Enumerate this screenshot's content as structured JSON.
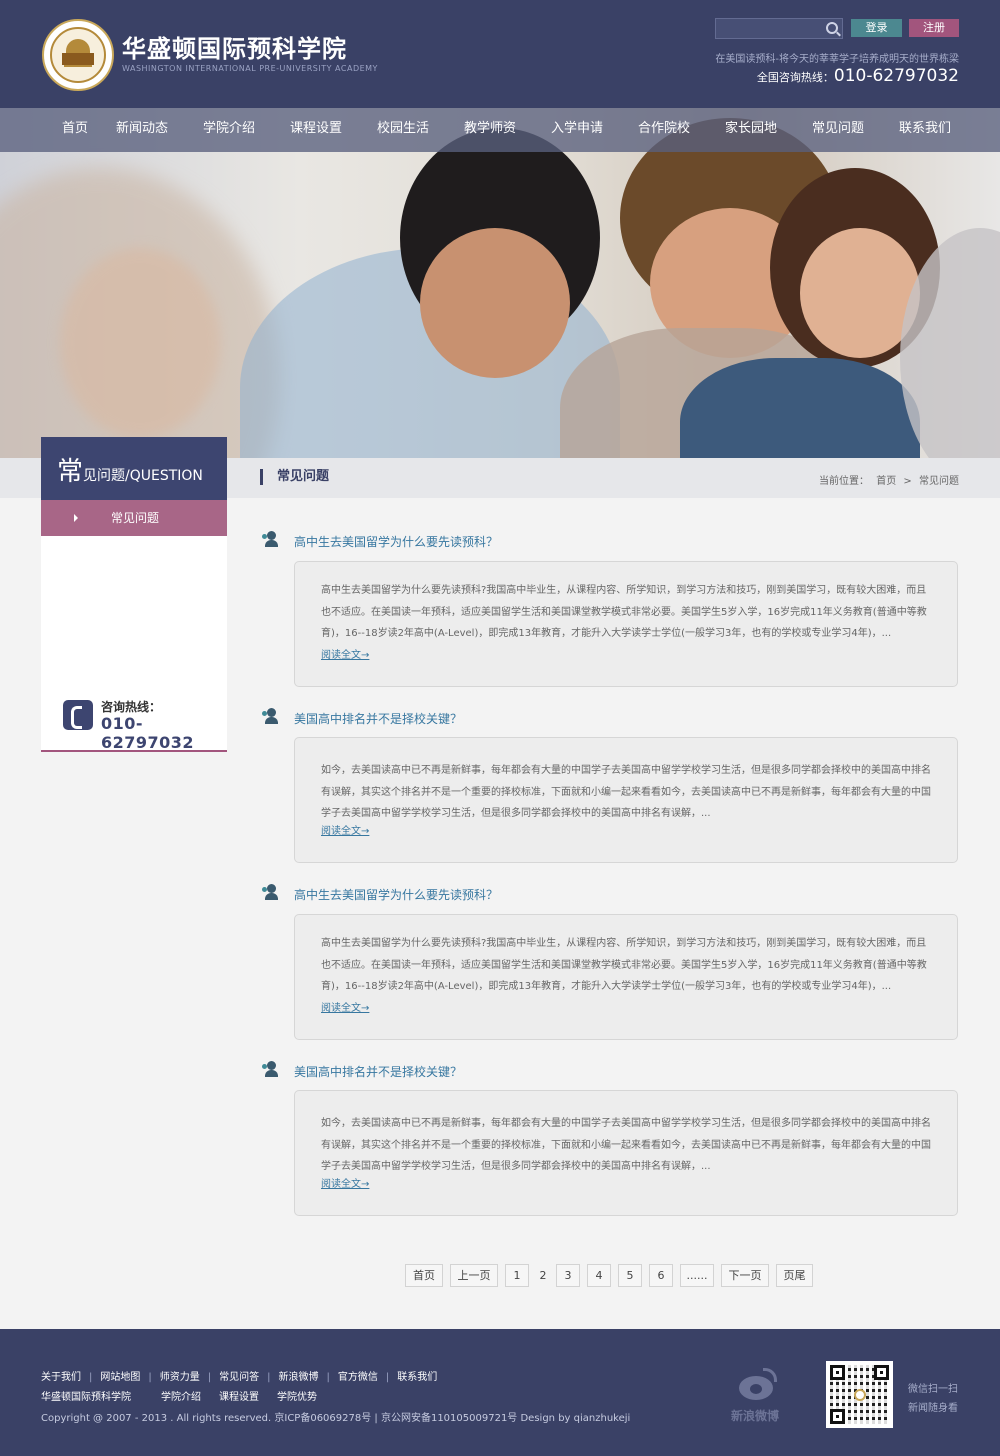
{
  "header": {
    "site_name": "华盛顿国际预科学院",
    "site_name_en": "WASHINGTON INTERNATIONAL PRE-UNIVERSITY ACADEMY",
    "search_placeholder": "",
    "login_label": "登录",
    "register_label": "注册",
    "slogan": "在美国读预科-将今天的莘莘学子培养成明天的世界栋梁",
    "hotline_label": "全国咨询热线：",
    "hotline_number": "010-62797032"
  },
  "nav": {
    "items": [
      {
        "label": "首页"
      },
      {
        "label": "新闻动态"
      },
      {
        "label": "学院介绍"
      },
      {
        "label": "课程设置"
      },
      {
        "label": "校园生活"
      },
      {
        "label": "教学师资"
      },
      {
        "label": "入学申请"
      },
      {
        "label": "合作院校"
      },
      {
        "label": "家长园地"
      },
      {
        "label": "常见问题"
      },
      {
        "label": "联系我们"
      }
    ]
  },
  "sidebar": {
    "title_big": "常",
    "title_rest": "见问题/QUESTION",
    "items": [
      {
        "label": "常见问题"
      }
    ],
    "hotline_label": "咨询热线：",
    "hotline_number": "010-62797032"
  },
  "main": {
    "section_title": "常见问题",
    "breadcrumb": {
      "prefix": "当前位置：",
      "home": "首页",
      "sep": ">",
      "current": "常见问题"
    },
    "read_more": "阅读全文→",
    "articles": [
      {
        "title": "高中生去美国留学为什么要先读预科？",
        "excerpt": "高中生去美国留学为什么要先读预科?我国高中毕业生，从课程内容、所学知识，到学习方法和技巧，刚到美国学习，既有较大困难，而且也不适应。在美国读一年预科，适应美国留学生活和美国课堂教学模式非常必要。美国学生5岁入学，16岁完成11年义务教育(普通中等教育)，16--18岁读2年高中(A-Level)，即完成13年教育，才能升入大学读学士学位(一般学习3年，也有的学校或专业学习4年)，..."
      },
      {
        "title": "美国高中排名并不是择校关键？",
        "excerpt": "如今，去美国读高中已不再是新鲜事，每年都会有大量的中国学子去美国高中留学学校学习生活，但是很多同学都会择校中的美国高中排名有误解，其实这个排名并不是一个重要的择校标准，下面就和小编一起来看看如今，去美国读高中已不再是新鲜事，每年都会有大量的中国学子去美国高中留学学校学习生活，但是很多同学都会择校中的美国高中排名有误解，..."
      },
      {
        "title": "高中生去美国留学为什么要先读预科？",
        "excerpt": "高中生去美国留学为什么要先读预科?我国高中毕业生，从课程内容、所学知识，到学习方法和技巧，刚到美国学习，既有较大困难，而且也不适应。在美国读一年预科，适应美国留学生活和美国课堂教学模式非常必要。美国学生5岁入学，16岁完成11年义务教育(普通中等教育)，16--18岁读2年高中(A-Level)，即完成13年教育，才能升入大学读学士学位(一般学习3年，也有的学校或专业学习4年)，..."
      },
      {
        "title": "美国高中排名并不是择校关键？",
        "excerpt": "如今，去美国读高中已不再是新鲜事，每年都会有大量的中国学子去美国高中留学学校学习生活，但是很多同学都会择校中的美国高中排名有误解，其实这个排名并不是一个重要的择校标准，下面就和小编一起来看看如今，去美国读高中已不再是新鲜事，每年都会有大量的中国学子去美国高中留学学校学习生活，但是很多同学都会择校中的美国高中排名有误解，..."
      }
    ]
  },
  "pagination": {
    "first": "首页",
    "prev": "上一页",
    "pages": [
      "1",
      "2",
      "3",
      "4",
      "5",
      "6"
    ],
    "current": "2",
    "ellipsis": "......",
    "next": "下一页",
    "last": "页尾"
  },
  "footer": {
    "links_row1": [
      "关于我们",
      "网站地图",
      "师资力量",
      "常见问答",
      "新浪微博",
      "官方微信",
      "联系我们"
    ],
    "links_row2": [
      "华盛顿国际预科学院",
      "学院介绍",
      "课程设置",
      "学院优势"
    ],
    "separator": "|",
    "copyright": "Copyright @ 2007 - 2013   . All rights reserved.   京ICP备06069278号 | 京公网安备1101050097​21号  Design by qianzhukeji",
    "weibo_label": "新浪微博",
    "wechat_line1": "微信扫一扫",
    "wechat_line2": "新闻随身看"
  },
  "colors": {
    "header_bg": "#3a4166",
    "accent_pink": "#a86687",
    "login_teal": "#4c8890",
    "link_blue": "#3777a0"
  }
}
